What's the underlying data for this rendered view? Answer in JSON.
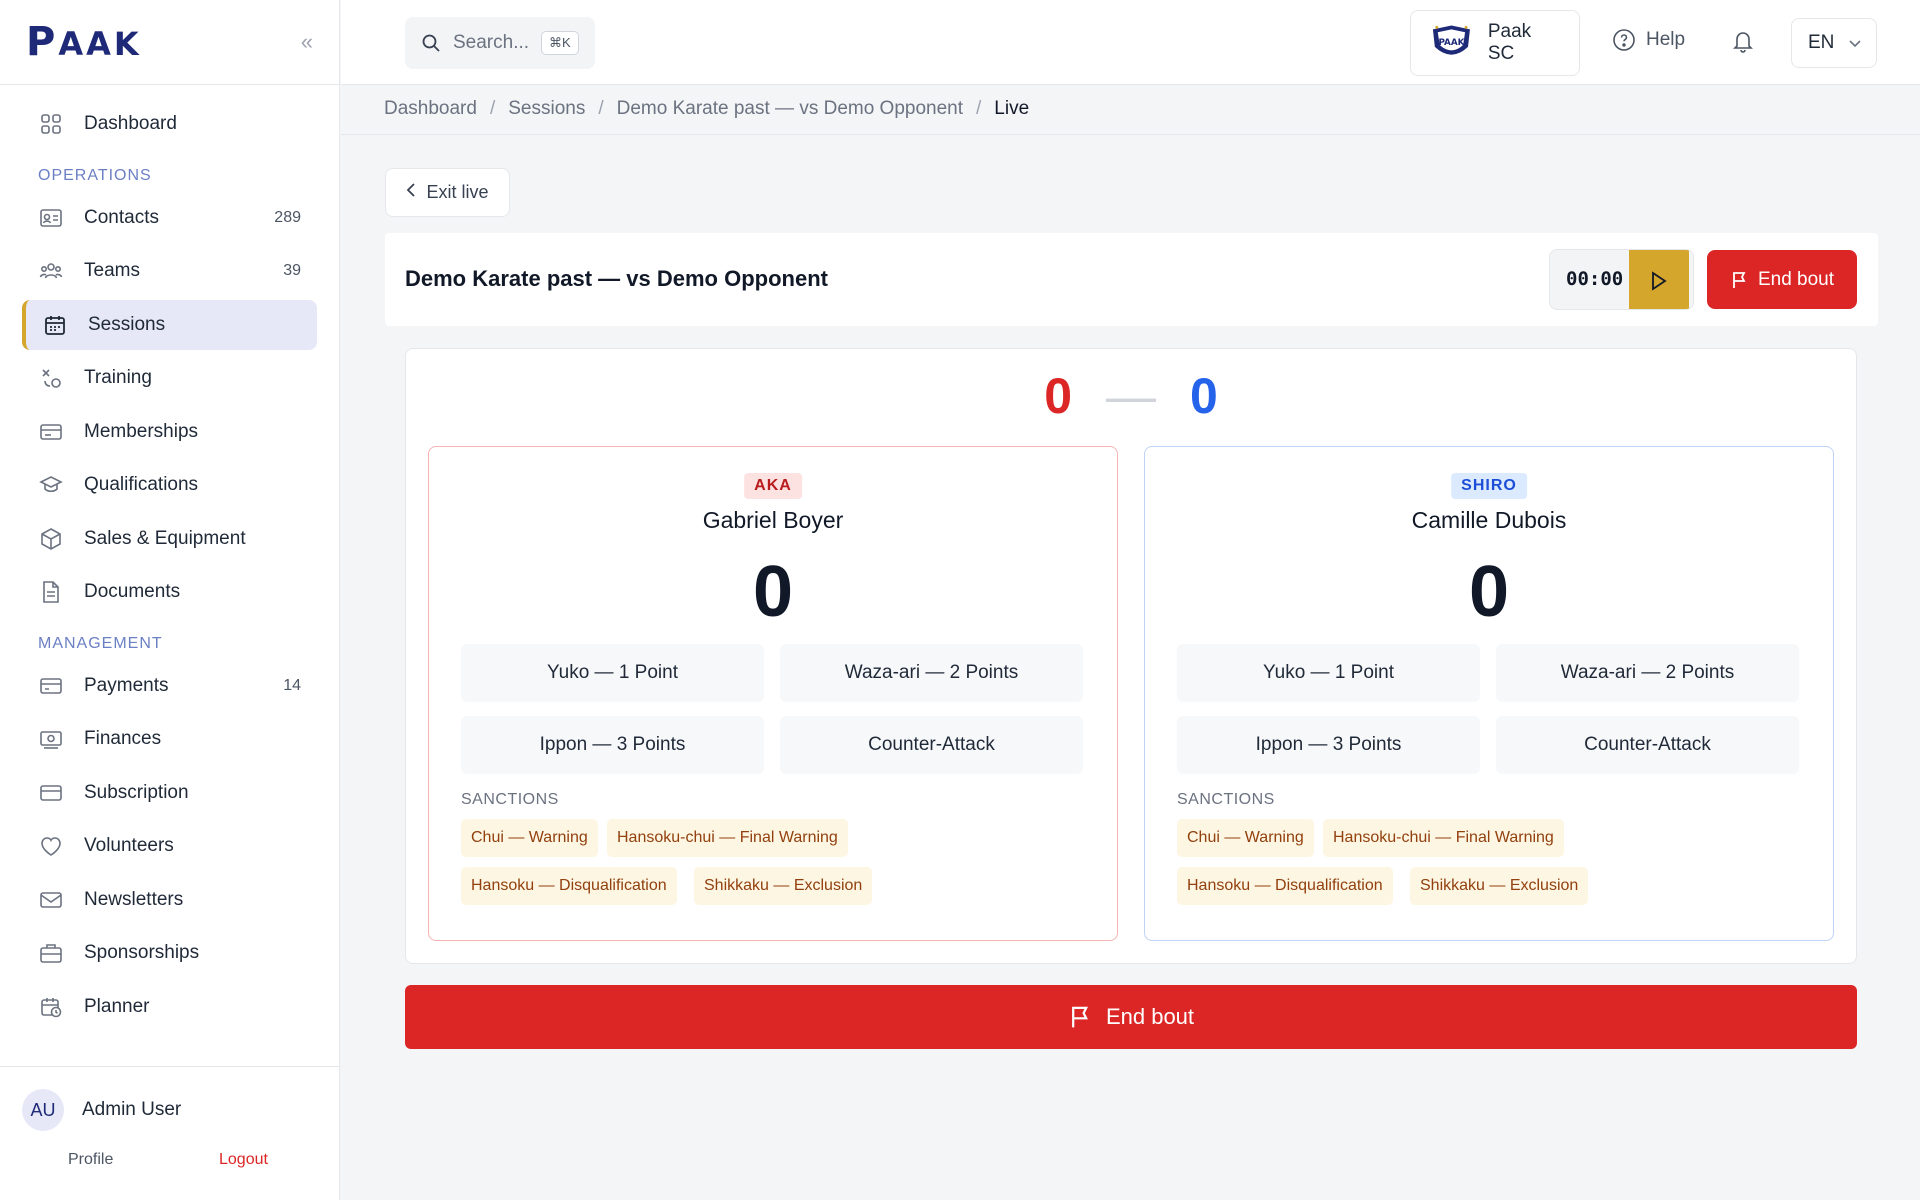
{
  "app": {
    "logo_main": "P",
    "logo_rest": "AAK",
    "collapse_icon": "double-chevron-left-icon"
  },
  "sidebar": {
    "dashboard": {
      "label": "Dashboard"
    },
    "section_operations": "OPERATIONS",
    "operations": [
      {
        "label": "Contacts",
        "count": "289",
        "icon": "contact-card-icon"
      },
      {
        "label": "Teams",
        "count": "39",
        "icon": "team-icon"
      },
      {
        "label": "Sessions",
        "count": "",
        "icon": "calendar-icon",
        "active": true
      },
      {
        "label": "Training",
        "count": "",
        "icon": "training-icon"
      },
      {
        "label": "Memberships",
        "count": "",
        "icon": "ticket-icon"
      },
      {
        "label": "Qualifications",
        "count": "",
        "icon": "graduation-cap-icon"
      },
      {
        "label": "Sales & Equipment",
        "count": "",
        "icon": "box-icon"
      },
      {
        "label": "Documents",
        "count": "",
        "icon": "document-icon"
      }
    ],
    "section_management": "MANAGEMENT",
    "management": [
      {
        "label": "Payments",
        "count": "14",
        "icon": "payment-icon"
      },
      {
        "label": "Finances",
        "count": "",
        "icon": "money-icon"
      },
      {
        "label": "Subscription",
        "count": "",
        "icon": "card-icon"
      },
      {
        "label": "Volunteers",
        "count": "",
        "icon": "heart-icon"
      },
      {
        "label": "Newsletters",
        "count": "",
        "icon": "mail-icon"
      },
      {
        "label": "Sponsorships",
        "count": "",
        "icon": "briefcase-icon"
      },
      {
        "label": "Planner",
        "count": "",
        "icon": "calendar-clock-icon"
      }
    ],
    "user": {
      "initials": "AU",
      "name": "Admin User",
      "profile": "Profile",
      "logout": "Logout"
    }
  },
  "topbar": {
    "search_placeholder": "Search...",
    "search_shortcut": "⌘K",
    "club_name": "Paak SC",
    "help": "Help",
    "language": "EN"
  },
  "breadcrumb": [
    "Dashboard",
    "Sessions",
    "Demo Karate past — vs Demo Opponent",
    "Live"
  ],
  "exit_live": "Exit live",
  "bout": {
    "title": "Demo Karate past — vs Demo Opponent",
    "timer": "00:00",
    "end_bout": "End bout",
    "score_aka": "0",
    "score_shiro": "0",
    "score_separator": "—"
  },
  "fighters": {
    "aka": {
      "corner": "AKA",
      "name": "Gabriel Boyer",
      "score": "0",
      "actions": [
        "Yuko — 1 Point",
        "Waza-ari — 2 Points",
        "Ippon — 3 Points",
        "Counter-Attack"
      ],
      "sanctions_label": "SANCTIONS",
      "sanctions": [
        "Chui — Warning",
        "Hansoku-chui — Final Warning",
        "Hansoku — Disqualification",
        "Shikkaku — Exclusion"
      ]
    },
    "shiro": {
      "corner": "SHIRO",
      "name": "Camille Dubois",
      "score": "0",
      "actions": [
        "Yuko — 1 Point",
        "Waza-ari — 2 Points",
        "Ippon — 3 Points",
        "Counter-Attack"
      ],
      "sanctions_label": "SANCTIONS",
      "sanctions": [
        "Chui — Warning",
        "Hansoku-chui — Final Warning",
        "Hansoku — Disqualification",
        "Shikkaku — Exclusion"
      ]
    }
  },
  "colors": {
    "brand": "#1e2a78",
    "accent": "#d4a72c",
    "danger": "#dc2626",
    "aka": "#dc2626",
    "shiro": "#2563eb"
  }
}
